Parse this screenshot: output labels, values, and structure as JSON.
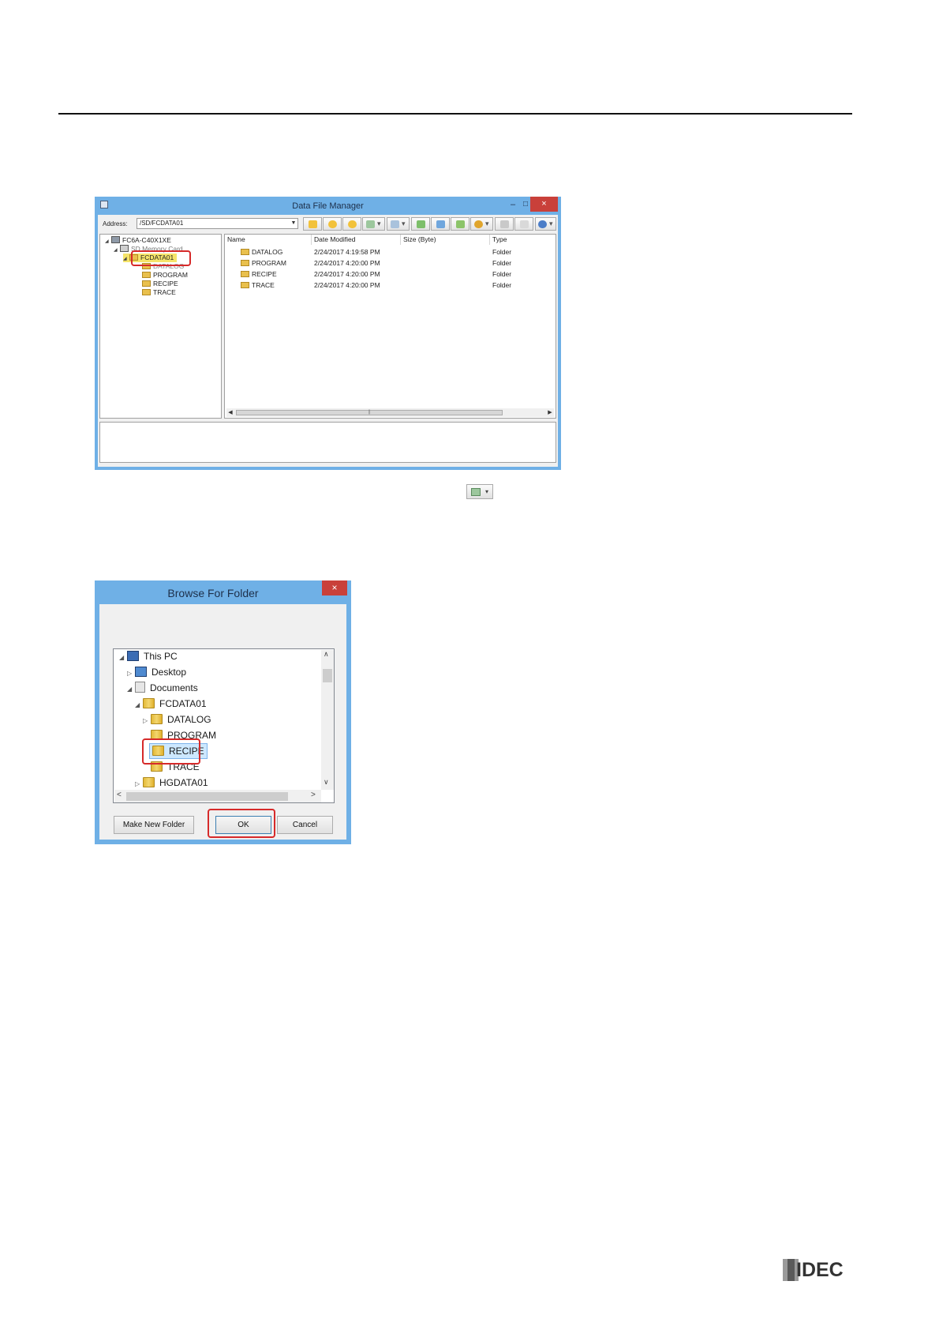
{
  "page": {
    "logo_text": "IDEC"
  },
  "dfm": {
    "title": "Data File Manager",
    "minimize_glyph": "–",
    "maximize_glyph": "□",
    "close_glyph": "×",
    "address_label": "Address:",
    "address_value": "/SD/FCDATA01",
    "tree": {
      "root": "FC6A-C40X1XE",
      "card": "SD Memory Card",
      "selected": "FCDATA01",
      "children": [
        "DATALOG",
        "PROGRAM",
        "RECIPE",
        "TRACE"
      ]
    },
    "columns": [
      "Name",
      "Date Modified",
      "Size (Byte)",
      "Type"
    ],
    "rows": [
      {
        "name": "DATALOG",
        "date": "2/24/2017 4:19:58 PM",
        "type": "Folder"
      },
      {
        "name": "PROGRAM",
        "date": "2/24/2017 4:20:00 PM",
        "type": "Folder"
      },
      {
        "name": "RECIPE",
        "date": "2/24/2017 4:20:00 PM",
        "type": "Folder"
      },
      {
        "name": "TRACE",
        "date": "2/24/2017 4:20:00 PM",
        "type": "Folder"
      }
    ],
    "toolbar_icons": [
      "add-icon",
      "open-icon",
      "folder-icon",
      "download-icon",
      "upload-icon",
      "refresh-icon",
      "copy-icon",
      "sync-icon",
      "format-icon",
      "paste-icon",
      "properties-icon",
      "help-icon"
    ],
    "colors": {
      "titlebar": "#6fb0e6",
      "close": "#c9403a",
      "highlight": "#d62a2a"
    }
  },
  "inline_icon": {
    "name": "download-to-pc-icon"
  },
  "browse": {
    "title": "Browse For Folder",
    "close_glyph": "×",
    "items": [
      {
        "label": "This PC"
      },
      {
        "label": "Desktop"
      },
      {
        "label": "Documents"
      },
      {
        "label": "FCDATA01"
      },
      {
        "label": "DATALOG"
      },
      {
        "label": "PROGRAM"
      },
      {
        "label": "RECIPE"
      },
      {
        "label": "TRACE"
      },
      {
        "label": "HGDATA01"
      }
    ],
    "buttons": {
      "new_folder": "Make New Folder",
      "ok": "OK",
      "cancel": "Cancel"
    }
  }
}
